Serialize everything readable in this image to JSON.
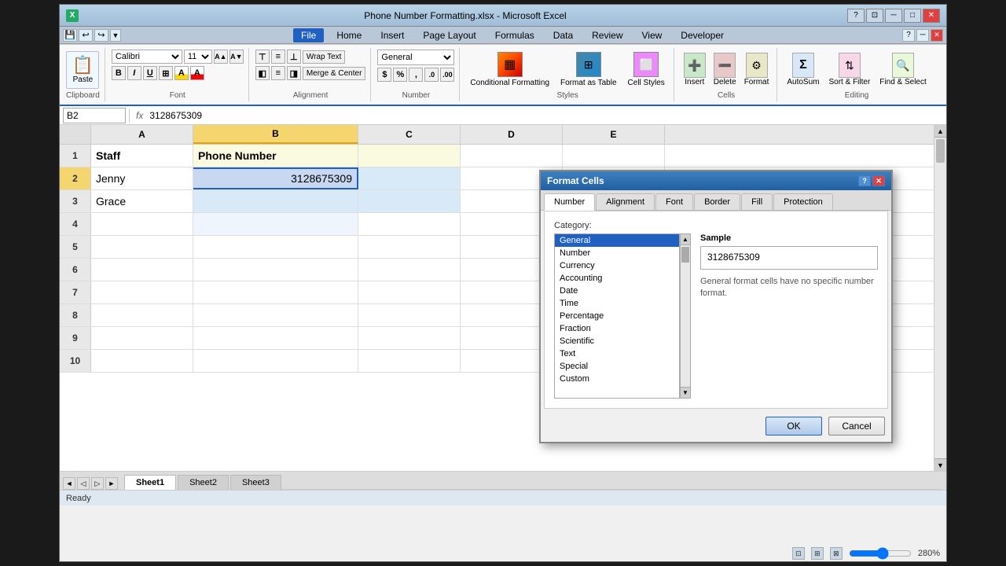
{
  "window": {
    "title": "Phone Number Formatting.xlsx - Microsoft Excel",
    "icon": "X"
  },
  "quickaccess": {
    "buttons": [
      "💾",
      "↩",
      "↪",
      "▼"
    ]
  },
  "ribbon": {
    "tabs": [
      "File",
      "Home",
      "Insert",
      "Page Layout",
      "Formulas",
      "Data",
      "Review",
      "View",
      "Developer"
    ],
    "active_tab": "Home",
    "groups": {
      "clipboard": {
        "label": "Clipboard",
        "paste_label": "Paste"
      },
      "font": {
        "label": "Font",
        "font_name": "Calibri",
        "font_size": "11",
        "bold": "B",
        "italic": "I",
        "underline": "U"
      },
      "alignment": {
        "label": "Alignment",
        "wrap_text": "Wrap Text",
        "merge_center": "Merge & Center"
      },
      "number": {
        "label": "Number",
        "format": "General",
        "dollar": "$",
        "percent": "%",
        "comma": ","
      },
      "styles": {
        "label": "Styles",
        "conditional": "Conditional\nFormatting",
        "format_as_table": "Format\nas Table",
        "cell_styles": "Cell Styles"
      },
      "cells": {
        "label": "Cells",
        "insert": "Insert",
        "delete": "Delete",
        "format": "Format"
      },
      "editing": {
        "label": "Editing",
        "autosum": "AutoSum",
        "sort_filter": "Sort &\nFilter",
        "find_select": "Find &\nSelect"
      }
    }
  },
  "formula_bar": {
    "name_box": "B2",
    "fx": "fx",
    "formula": "3128675309"
  },
  "spreadsheet": {
    "columns": [
      "A",
      "B",
      "C",
      "D",
      "E"
    ],
    "active_col": "B",
    "active_cell": "B2",
    "rows": [
      {
        "num": "1",
        "cells": [
          "Staff",
          "Phone Number",
          "",
          "",
          ""
        ]
      },
      {
        "num": "2",
        "cells": [
          "Jenny",
          "3128675309",
          "",
          "",
          ""
        ]
      },
      {
        "num": "3",
        "cells": [
          "Grace",
          "",
          "",
          "",
          ""
        ]
      },
      {
        "num": "4",
        "cells": [
          "",
          "",
          "",
          "",
          ""
        ]
      },
      {
        "num": "5",
        "cells": [
          "",
          "",
          "",
          "",
          ""
        ]
      },
      {
        "num": "6",
        "cells": [
          "",
          "",
          "",
          "",
          ""
        ]
      },
      {
        "num": "7",
        "cells": [
          "",
          "",
          "",
          "",
          ""
        ]
      },
      {
        "num": "8",
        "cells": [
          "",
          "",
          "",
          "",
          ""
        ]
      },
      {
        "num": "9",
        "cells": [
          "",
          "",
          "",
          "",
          ""
        ]
      },
      {
        "num": "10",
        "cells": [
          "",
          "",
          "",
          "",
          ""
        ]
      }
    ]
  },
  "sheet_tabs": [
    "Sheet1",
    "Sheet2",
    "Sheet3"
  ],
  "active_sheet": "Sheet1",
  "status_bar": {
    "ready": "Ready",
    "zoom": "280%"
  },
  "dialog": {
    "title": "Format Cells",
    "tabs": [
      "Number",
      "Alignment",
      "Font",
      "Border",
      "Fill",
      "Protection"
    ],
    "active_tab": "Number",
    "category_label": "Category:",
    "categories": [
      "General",
      "Number",
      "Currency",
      "Accounting",
      "Date",
      "Time",
      "Percentage",
      "Fraction",
      "Scientific",
      "Text",
      "Special",
      "Custom"
    ],
    "selected_category": "General",
    "sample_label": "Sample",
    "sample_value": "3128675309",
    "description": "General format cells have no specific number format.",
    "ok_label": "OK",
    "cancel_label": "Cancel"
  }
}
